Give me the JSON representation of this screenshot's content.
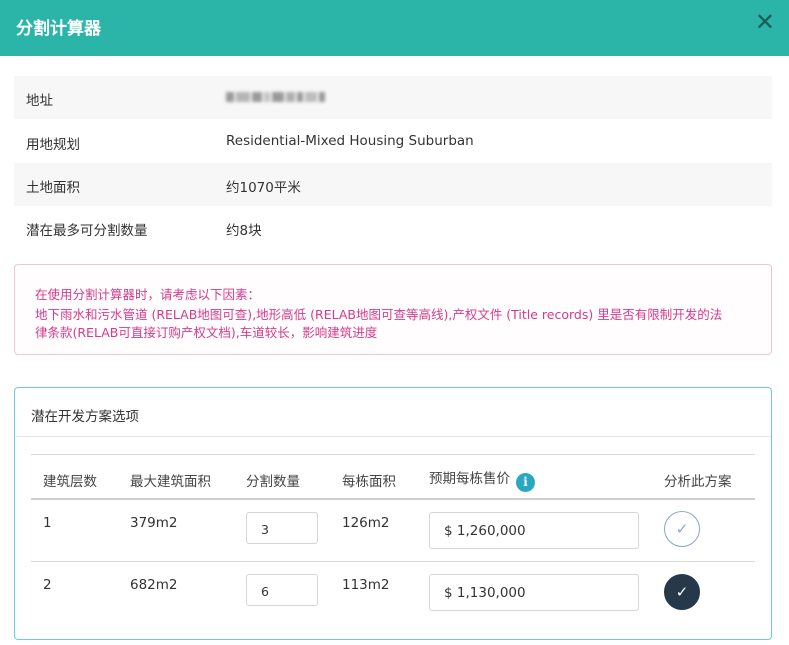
{
  "dialog": {
    "title": "分割计算器",
    "close_icon": "close-icon"
  },
  "info": [
    {
      "label": "地址",
      "value": ""
    },
    {
      "label": "用地规划",
      "value": "Residential-Mixed Housing Suburban"
    },
    {
      "label": "土地面积",
      "value": "约1070平米"
    },
    {
      "label": "潜在最多可分割数量",
      "value": "约8块"
    }
  ],
  "warning": {
    "line1": "在使用分割计算器时，请考虑以下因素：",
    "line2": "地下雨水和污水管道 (RELAB地图可查),地形高低 (RELAB地图可查等高线),产权文件 (Title records) 里是否有限制开发的法",
    "line3": "律条款(RELAB可直接订购产权文档),车道较长，影响建筑进度"
  },
  "options_panel": {
    "title": "潜在开发方案选项",
    "columns": [
      "建筑层数",
      "最大建筑面积",
      "分割数量",
      "每栋面积",
      "预期每栋售价",
      "分析此方案"
    ],
    "info_icon": "i",
    "rows": [
      {
        "floors": "1",
        "max_area": "379m2",
        "subdivisions": "3",
        "area_each": "126m2",
        "price": "$ 1,260,000",
        "selected": false
      },
      {
        "floors": "2",
        "max_area": "682m2",
        "subdivisions": "6",
        "area_each": "113m2",
        "price": "$ 1,130,000",
        "selected": true
      }
    ]
  },
  "icons": {
    "check": "✓",
    "close": "✕"
  }
}
